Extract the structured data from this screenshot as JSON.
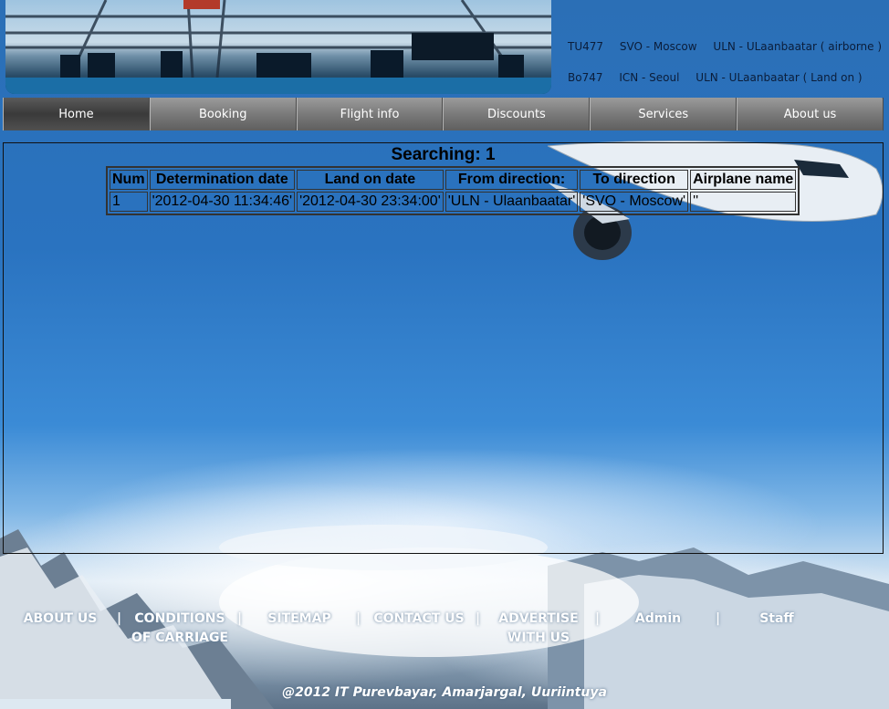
{
  "flights": [
    {
      "code": "TU477",
      "route": "SVO - Moscow",
      "status": "ULN - ULaanbaatar ( airborne )"
    },
    {
      "code": "Bo747",
      "route": "ICN - Seoul",
      "status": "ULN - ULaanbaatar ( Land on )"
    }
  ],
  "nav": {
    "home": "Home",
    "booking": "Booking",
    "flight_info": "Flight info",
    "discounts": "Discounts",
    "services": "Services",
    "about": "About us"
  },
  "search": {
    "title": "Searching: 1",
    "columns": [
      "Num",
      "Determination date",
      "Land on date",
      "From direction:",
      "To direction",
      "Airplane name"
    ],
    "rows": [
      [
        "1",
        "'2012-04-30 11:34:46'",
        "'2012-04-30 23:34:00'",
        "'ULN - Ulaanbaatar'",
        "'SVO - Moscow'",
        "''"
      ]
    ]
  },
  "footer": {
    "about": "ABOUT US",
    "conditions_1": "CONDITIONS",
    "conditions_2": "OF CARRIAGE",
    "sitemap": "SITEMAP",
    "contact": "CONTACT US",
    "advertise_1": "ADVERTISE",
    "advertise_2": "WITH US",
    "admin": "Admin",
    "staff": "Staff",
    "separator": "|",
    "copyright": "@2012 IT Purevbayar, Amarjargal, Uuriintuya"
  },
  "colors": {
    "nav_bg": "#7a7a7a",
    "sky": "#2a73c0"
  }
}
